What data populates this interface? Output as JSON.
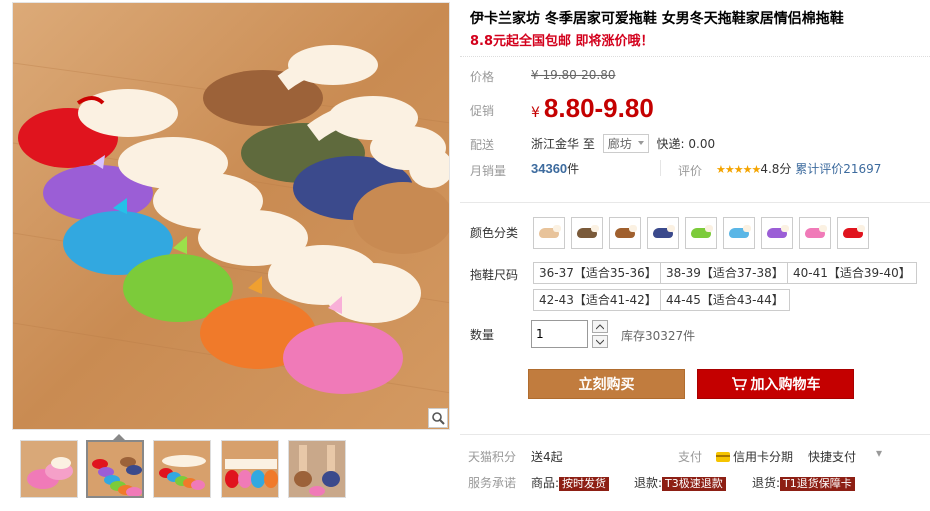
{
  "product": {
    "title": "伊卡兰家坊 冬季居家可爱拖鞋 女男冬天拖鞋家居情侣棉拖鞋",
    "subtitle": "8.8元起全国包邮 即将涨价哦！"
  },
  "price": {
    "label": "价格",
    "original": "¥ 19.80-20.80",
    "promo_label": "促销",
    "promo_currency": "¥",
    "promo_value": "8.80-9.80"
  },
  "shipping": {
    "label": "配送",
    "from": "浙江金华",
    "to_word": "至",
    "to_city": "廊坊",
    "fee": "快递: 0.00"
  },
  "sales": {
    "label": "月销量",
    "count": "34360",
    "unit": "件",
    "rating_label": "评价",
    "stars": "★★★★★",
    "score": "4.8分",
    "reviews": "累计评价21697"
  },
  "color": {
    "label": "颜色分类",
    "swatches": [
      {
        "name": "swatch-beige",
        "color": "#e8c39a"
      },
      {
        "name": "swatch-brown",
        "color": "#7a5a3a"
      },
      {
        "name": "swatch-coffee",
        "color": "#a0602e"
      },
      {
        "name": "swatch-navy",
        "color": "#3b4a8c"
      },
      {
        "name": "swatch-green",
        "color": "#7ccb3a"
      },
      {
        "name": "swatch-skyblue",
        "color": "#5ab6e6"
      },
      {
        "name": "swatch-purple",
        "color": "#9b5ed6"
      },
      {
        "name": "swatch-pink",
        "color": "#f07ab8"
      },
      {
        "name": "swatch-red",
        "color": "#e0141e"
      }
    ]
  },
  "size": {
    "label": "拖鞋尺码",
    "options": [
      "36-37【适合35-36】",
      "38-39【适合37-38】",
      "40-41【适合39-40】",
      "42-43【适合41-42】",
      "44-45【适合43-44】"
    ]
  },
  "quantity": {
    "label": "数量",
    "value": "1",
    "stock": "库存30327件"
  },
  "buttons": {
    "buy": "立刻购买",
    "cart": "加入购物车"
  },
  "service": {
    "points_label": "天猫积分",
    "points_value": "送4起",
    "pay_label": "支付",
    "pay_card": "信用卡分期",
    "pay_quick": "快捷支付",
    "promise_label": "服务承诺",
    "goods_label": "商品:",
    "goods_tag": "按时发货",
    "refund_label": "退款:",
    "refund_code": "T3",
    "refund_tag": "极速退款",
    "return_label": "退货:",
    "return_code": "T1",
    "return_tag": "退货保障卡"
  },
  "colors": {
    "accent_red": "#c40000",
    "buy_orange": "#c17c3e",
    "link_blue": "#3d6b9e"
  }
}
